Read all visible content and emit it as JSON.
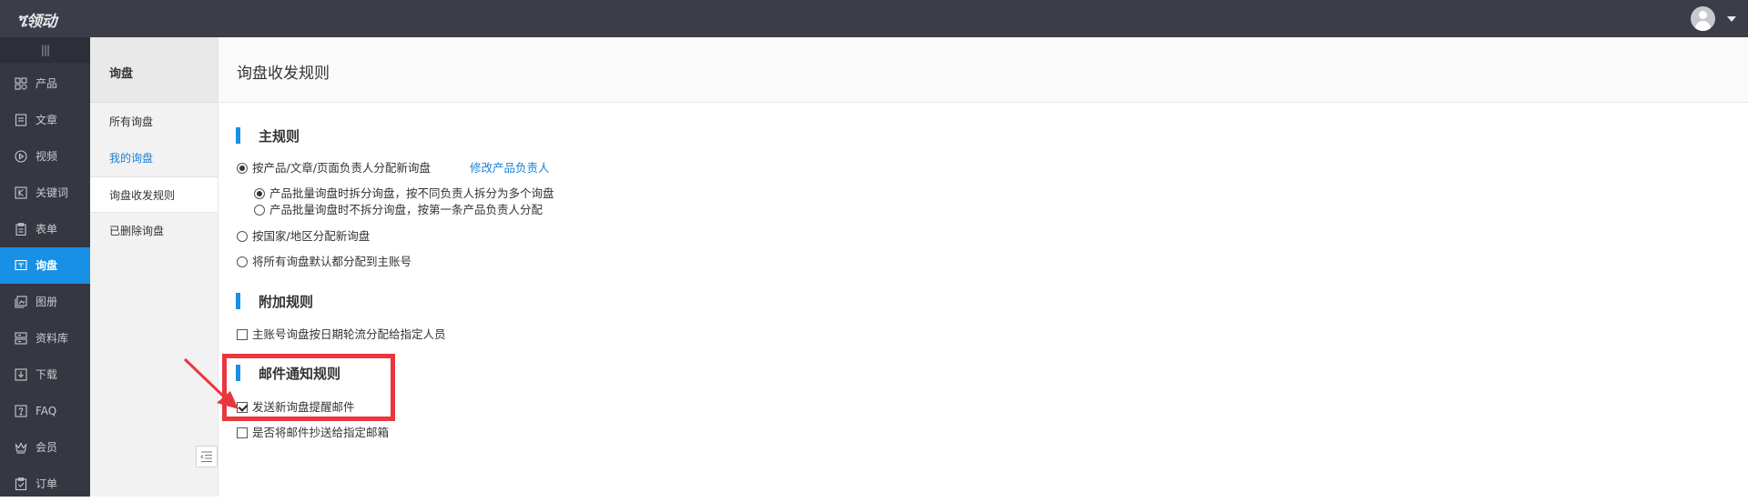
{
  "app": {
    "logo_text": "ጜ领动",
    "user_menu_icon": "user-avatar-icon"
  },
  "leftnav": {
    "collapse_label": "|||",
    "items": [
      {
        "label": "产品",
        "icon": "product-grid-icon"
      },
      {
        "label": "文章",
        "icon": "article-icon"
      },
      {
        "label": "视频",
        "icon": "video-play-icon"
      },
      {
        "label": "关键词",
        "icon": "keyword-k-icon"
      },
      {
        "label": "表单",
        "icon": "form-clipboard-icon"
      },
      {
        "label": "询盘",
        "icon": "inquiry-icon",
        "active": true
      },
      {
        "label": "图册",
        "icon": "gallery-icon"
      },
      {
        "label": "资料库",
        "icon": "library-icon"
      },
      {
        "label": "下载",
        "icon": "download-icon"
      },
      {
        "label": "FAQ",
        "icon": "faq-icon"
      },
      {
        "label": "会员",
        "icon": "crown-icon"
      },
      {
        "label": "订单",
        "icon": "order-icon"
      }
    ]
  },
  "subnav": {
    "title": "询盘",
    "items": [
      {
        "label": "所有询盘"
      },
      {
        "label": "我的询盘"
      },
      {
        "label": "询盘收发规则",
        "current": true
      },
      {
        "label": "已删除询盘"
      }
    ]
  },
  "main": {
    "title": "询盘收发规则",
    "main_rules": {
      "heading": "主规则",
      "option_owner": "按产品/文章/页面负责人分配新询盘",
      "edit_owner_link": "修改产品负责人",
      "sub_split": "产品批量询盘时拆分询盘，按不同负责人拆分为多个询盘",
      "sub_no_split": "产品批量询盘时不拆分询盘，按第一条产品负责人分配",
      "option_country": "按国家/地区分配新询盘",
      "option_master": "将所有询盘默认都分配到主账号"
    },
    "extra_rules": {
      "heading": "附加规则",
      "option_rotate": "主账号询盘按日期轮流分配给指定人员"
    },
    "email_rules": {
      "heading": "邮件通知规则",
      "option_send": "发送新询盘提醒邮件",
      "option_cc": "是否将邮件抄送给指定邮箱"
    }
  },
  "colors": {
    "accent": "#1890e6",
    "highlight": "#e8373e",
    "topbar": "#3b3d48"
  }
}
